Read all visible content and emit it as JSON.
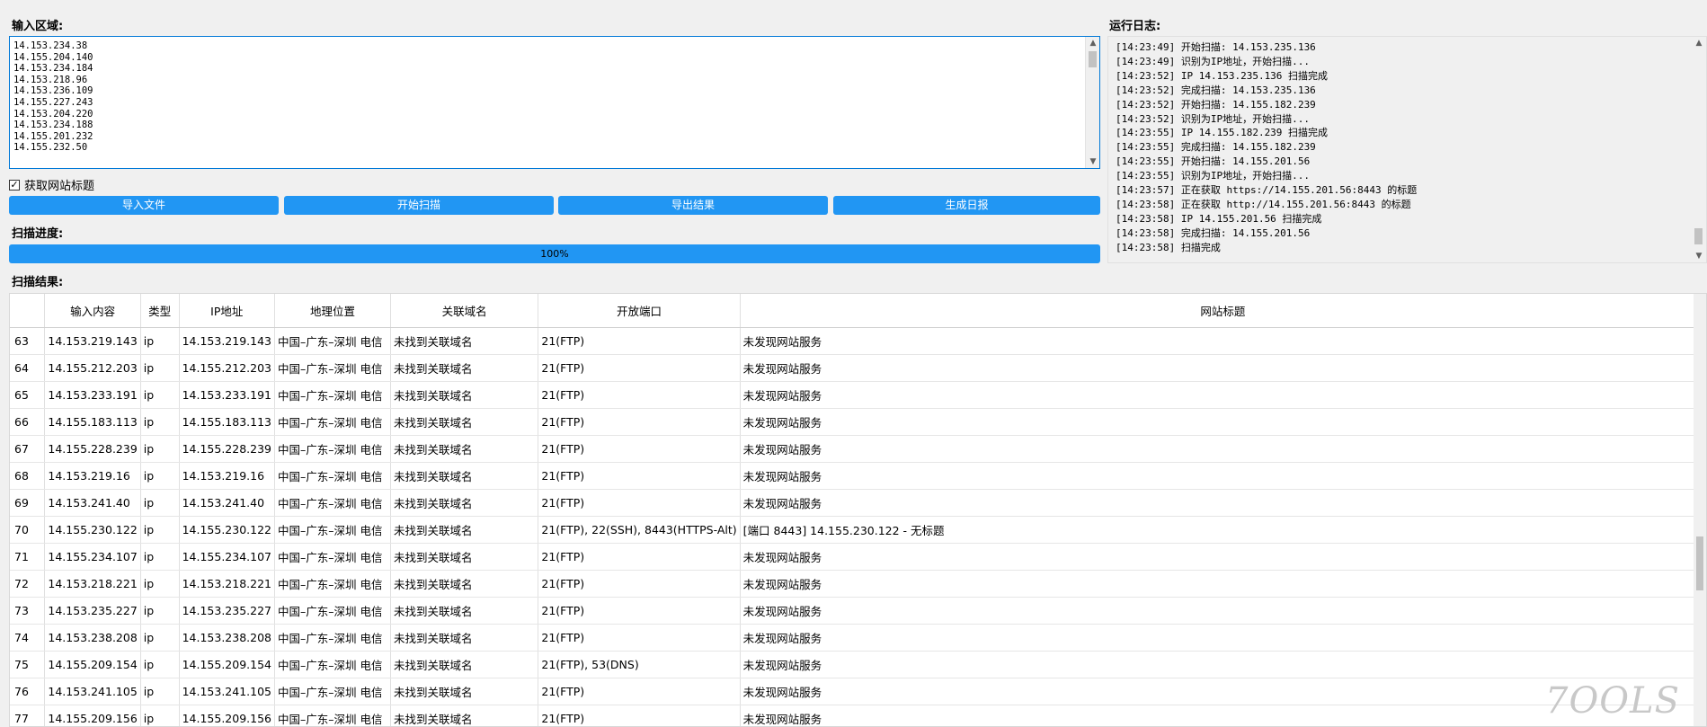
{
  "labels": {
    "input_area": "输入区域:",
    "log_area": "运行日志:",
    "progress": "扫描进度:",
    "results": "扫描结果:",
    "fetch_title": "获取网站标题"
  },
  "input_lines": [
    "14.153.234.38",
    "14.155.204.140",
    "14.153.234.184",
    "14.153.218.96",
    "14.153.236.109",
    "14.155.227.243",
    "14.153.204.220",
    "14.153.234.188",
    "14.155.201.232",
    "14.155.232.50"
  ],
  "checkbox_checked": true,
  "buttons": {
    "import": "导入文件",
    "start": "开始扫描",
    "export": "导出结果",
    "report": "生成日报"
  },
  "progress_text": "100%",
  "progress_value": 1.0,
  "log_lines": [
    "[14:23:49] 开始扫描: 14.153.235.136",
    "[14:23:49] 识别为IP地址，开始扫描...",
    "[14:23:52] IP 14.153.235.136 扫描完成",
    "[14:23:52] 完成扫描: 14.153.235.136",
    "[14:23:52] 开始扫描: 14.155.182.239",
    "[14:23:52] 识别为IP地址，开始扫描...",
    "[14:23:55] IP 14.155.182.239 扫描完成",
    "[14:23:55] 完成扫描: 14.155.182.239",
    "[14:23:55] 开始扫描: 14.155.201.56",
    "[14:23:55] 识别为IP地址，开始扫描...",
    "[14:23:57] 正在获取 https://14.155.201.56:8443 的标题",
    "[14:23:58] 正在获取 http://14.155.201.56:8443 的标题",
    "[14:23:58] IP 14.155.201.56 扫描完成",
    "[14:23:58] 完成扫描: 14.155.201.56",
    "[14:23:58] 扫描完成"
  ],
  "table": {
    "headers": [
      "",
      "输入内容",
      "类型",
      "IP地址",
      "地理位置",
      "关联域名",
      "开放端口",
      "网站标题"
    ],
    "rows": [
      [
        "63",
        "14.153.219.143",
        "ip",
        "14.153.219.143",
        "中国–广东–深圳 电信",
        "未找到关联域名",
        "21(FTP)",
        "未发现网站服务"
      ],
      [
        "64",
        "14.155.212.203",
        "ip",
        "14.155.212.203",
        "中国–广东–深圳 电信",
        "未找到关联域名",
        "21(FTP)",
        "未发现网站服务"
      ],
      [
        "65",
        "14.153.233.191",
        "ip",
        "14.153.233.191",
        "中国–广东–深圳 电信",
        "未找到关联域名",
        "21(FTP)",
        "未发现网站服务"
      ],
      [
        "66",
        "14.155.183.113",
        "ip",
        "14.155.183.113",
        "中国–广东–深圳 电信",
        "未找到关联域名",
        "21(FTP)",
        "未发现网站服务"
      ],
      [
        "67",
        "14.155.228.239",
        "ip",
        "14.155.228.239",
        "中国–广东–深圳 电信",
        "未找到关联域名",
        "21(FTP)",
        "未发现网站服务"
      ],
      [
        "68",
        "14.153.219.16",
        "ip",
        "14.153.219.16",
        "中国–广东–深圳 电信",
        "未找到关联域名",
        "21(FTP)",
        "未发现网站服务"
      ],
      [
        "69",
        "14.153.241.40",
        "ip",
        "14.153.241.40",
        "中国–广东–深圳 电信",
        "未找到关联域名",
        "21(FTP)",
        "未发现网站服务"
      ],
      [
        "70",
        "14.155.230.122",
        "ip",
        "14.155.230.122",
        "中国–广东–深圳 电信",
        "未找到关联域名",
        "21(FTP), 22(SSH), 8443(HTTPS-Alt)",
        "[端口 8443] 14.155.230.122 - 无标题"
      ],
      [
        "71",
        "14.155.234.107",
        "ip",
        "14.155.234.107",
        "中国–广东–深圳 电信",
        "未找到关联域名",
        "21(FTP)",
        "未发现网站服务"
      ],
      [
        "72",
        "14.153.218.221",
        "ip",
        "14.153.218.221",
        "中国–广东–深圳 电信",
        "未找到关联域名",
        "21(FTP)",
        "未发现网站服务"
      ],
      [
        "73",
        "14.153.235.227",
        "ip",
        "14.153.235.227",
        "中国–广东–深圳 电信",
        "未找到关联域名",
        "21(FTP)",
        "未发现网站服务"
      ],
      [
        "74",
        "14.153.238.208",
        "ip",
        "14.153.238.208",
        "中国–广东–深圳 电信",
        "未找到关联域名",
        "21(FTP)",
        "未发现网站服务"
      ],
      [
        "75",
        "14.155.209.154",
        "ip",
        "14.155.209.154",
        "中国–广东–深圳 电信",
        "未找到关联域名",
        "21(FTP), 53(DNS)",
        "未发现网站服务"
      ],
      [
        "76",
        "14.153.241.105",
        "ip",
        "14.153.241.105",
        "中国–广东–深圳 电信",
        "未找到关联域名",
        "21(FTP)",
        "未发现网站服务"
      ],
      [
        "77",
        "14.155.209.156",
        "ip",
        "14.155.209.156",
        "中国–广东–深圳 电信",
        "未找到关联域名",
        "21(FTP)",
        "未发现网站服务"
      ]
    ]
  },
  "watermark": "7OOLS",
  "colors": {
    "accent": "#2196f3",
    "focus_border": "#0078d7"
  }
}
